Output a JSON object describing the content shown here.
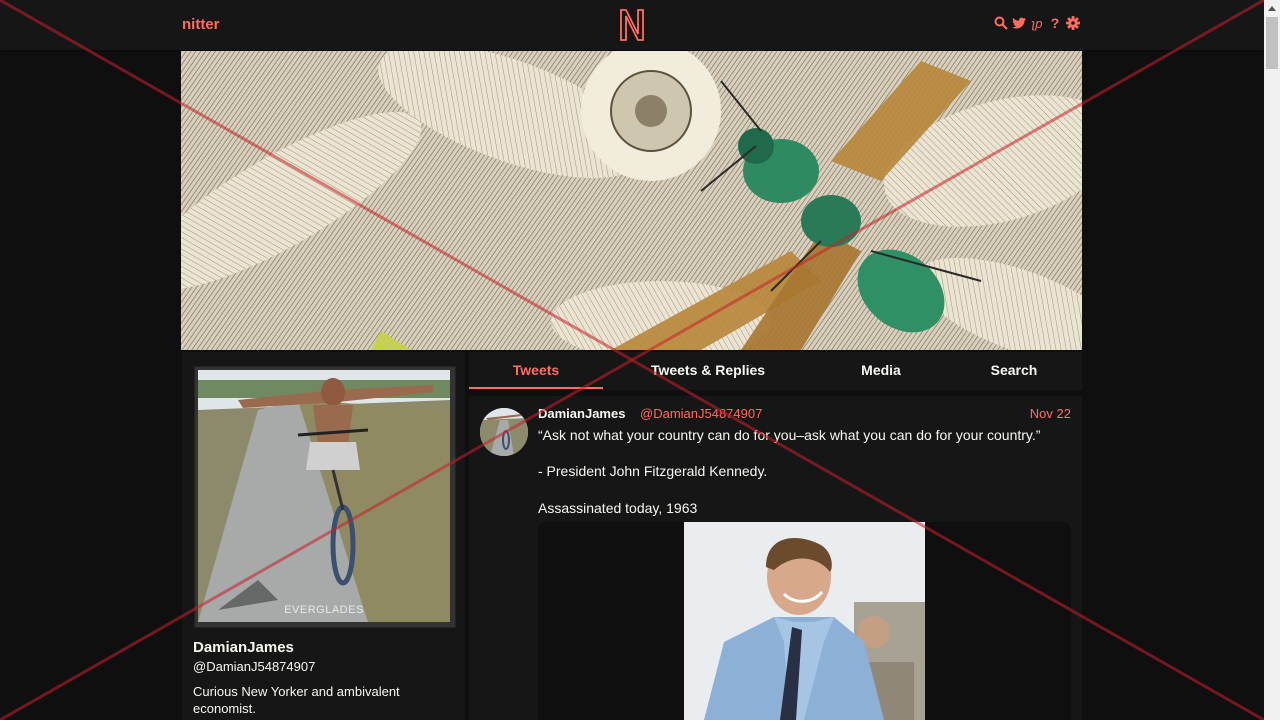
{
  "nav": {
    "site_name": "nitter",
    "logo_letter": "N",
    "icons": [
      "search-icon",
      "twitter-bird-icon",
      "rss-icon",
      "help-icon",
      "gear-icon"
    ],
    "icon_glyphs": {
      "help": "?",
      "rss": "ʅp"
    }
  },
  "colors": {
    "accent": "#ff6c60",
    "background": "#0f0f0f",
    "panel": "#161616",
    "text": "#f8f8f2"
  },
  "profile": {
    "fullname": "DamianJames",
    "username": "@DamianJ54874907",
    "bio": "Curious New Yorker and ambivalent economist.",
    "avatar_caption": "EVERGLADES"
  },
  "tabs": [
    {
      "label": "Tweets",
      "active": true
    },
    {
      "label": "Tweets & Replies",
      "active": false
    },
    {
      "label": "Media",
      "active": false
    },
    {
      "label": "Search",
      "active": false
    }
  ],
  "tweet": {
    "fullname": "DamianJames",
    "username": "@DamianJ54874907",
    "date": "Nov 22",
    "paragraphs": [
      "“Ask not what your country can do for you–ask what you can do for your country.”",
      "- President John Fitzgerald Kennedy.",
      "Assassinated today, 1963"
    ]
  }
}
